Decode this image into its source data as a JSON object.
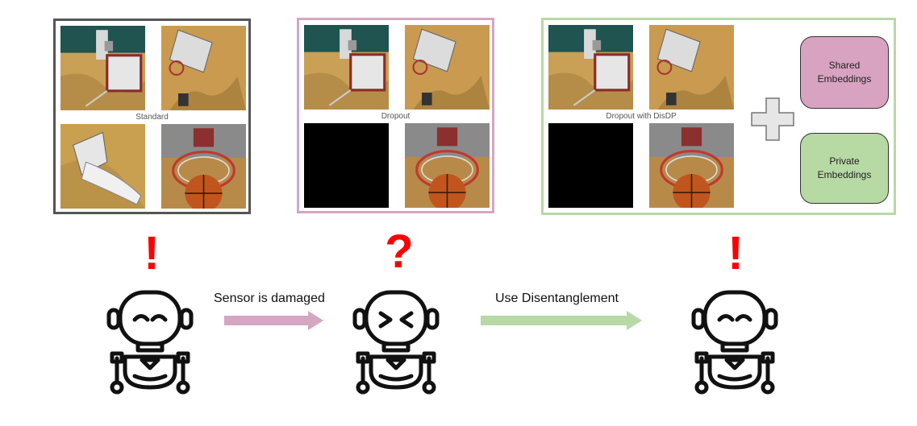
{
  "panels": [
    {
      "caption": "Standard",
      "border_color": "#555555",
      "dropped": false
    },
    {
      "caption": "Dropout",
      "border_color": "#d4a6c2",
      "dropped": true
    },
    {
      "caption": "Dropout with DisDP",
      "border_color": "#b8d9a6",
      "dropped": true
    }
  ],
  "embeddings": {
    "shared": {
      "label": "Shared Embeddings",
      "color": "#d7a3c0"
    },
    "private": {
      "label": "Private Embeddings",
      "color": "#b7d9a4"
    }
  },
  "indicators": [
    "!",
    "?",
    "!"
  ],
  "arrows": [
    {
      "label": "Sensor is damaged",
      "color": "#d4a6c2"
    },
    {
      "label": "Use Disentanglement",
      "color": "#b8d9a6"
    }
  ],
  "robots": [
    {
      "expression": "happy"
    },
    {
      "expression": "confused"
    },
    {
      "expression": "happy"
    }
  ],
  "plus_icon": "plus-icon",
  "robot_icon": "robot-icon"
}
